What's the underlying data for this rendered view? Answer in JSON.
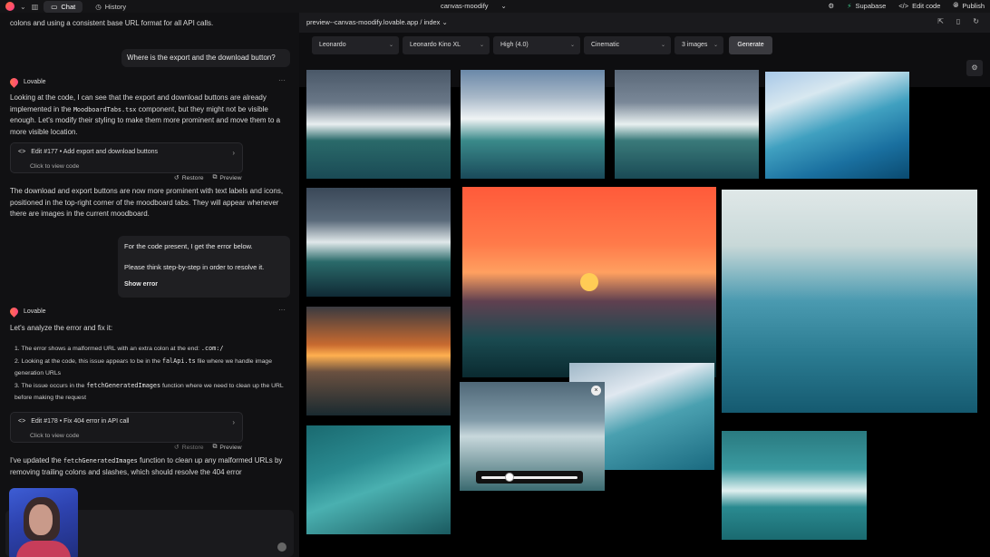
{
  "topbar": {
    "tabs": [
      {
        "label": "Chat",
        "icon": "chat-icon"
      },
      {
        "label": "History",
        "icon": "history-icon"
      }
    ],
    "project": "canvas-moodify",
    "actions": [
      {
        "label": "Supabase",
        "icon": "supabase-icon"
      },
      {
        "label": "Edit code",
        "icon": "code-icon"
      },
      {
        "label": "Publish",
        "icon": "globe-icon"
      }
    ]
  },
  "chat": {
    "intro_text": "colons and using a consistent base URL format for all API calls.",
    "user_msg_1": "Where is the export and the download button?",
    "author": "Lovable",
    "reply_1_a": "Looking at the code, I can see that the export and download buttons are already implemented in the",
    "reply_1_code": "MoodboardTabs.tsx",
    "reply_1_b": "component, but they might not be visible enough. Let's modify their styling to make them more prominent and move them to a more visible location.",
    "edit_1": {
      "title": "Edit #177 • Add export and download buttons",
      "sub": "Click to view code"
    },
    "restore_label": "Restore",
    "preview_label": "Preview",
    "reply_1_c": "The download and export buttons are now more prominent with text labels and icons, positioned in the top-right corner of the moodboard tabs. They will appear whenever there are images in the current moodboard.",
    "user_msg_2_a": "For the code present, I get the error below.",
    "user_msg_2_b": "Please think step-by-step in order to resolve it.",
    "show_error": "Show error",
    "reply_2_intro": "Let's analyze the error and fix it:",
    "steps": [
      {
        "n": "1.",
        "text": "The error shows a malformed URL with an extra colon at the end:",
        "code": ".com:/"
      },
      {
        "n": "2.",
        "text": "Looking at the code, this issue appears to be in the",
        "code": "falApi.ts",
        "text2": "file where we handle image generation URLs"
      },
      {
        "n": "3.",
        "text": "The issue occurs in the",
        "code": "fetchGeneratedImages",
        "text2": "function where we need to clean up the URL before making the request"
      }
    ],
    "edit_2": {
      "title": "Edit #178 • Fix 404 error in API call",
      "sub": "Click to view code"
    },
    "reply_2_a": "I've updated the",
    "reply_2_code": "fetchGeneratedImages",
    "reply_2_b": "function to clean up any malformed URLs by removing trailing colons and slashes, which should resolve the 404 error"
  },
  "preview": {
    "url": "preview--canvas-moodify.lovable.app / index",
    "controls": [
      {
        "label": "Leonardo"
      },
      {
        "label": "Leonardo Kino XL"
      },
      {
        "label": "High (4.0)"
      },
      {
        "label": "Cinematic"
      },
      {
        "label": "3 images"
      }
    ],
    "generate_label": "Generate"
  },
  "colors": {
    "accent": "#ff4d6d",
    "supabase": "#3ecf8e",
    "bg": "#000000",
    "panel": "#111113"
  }
}
